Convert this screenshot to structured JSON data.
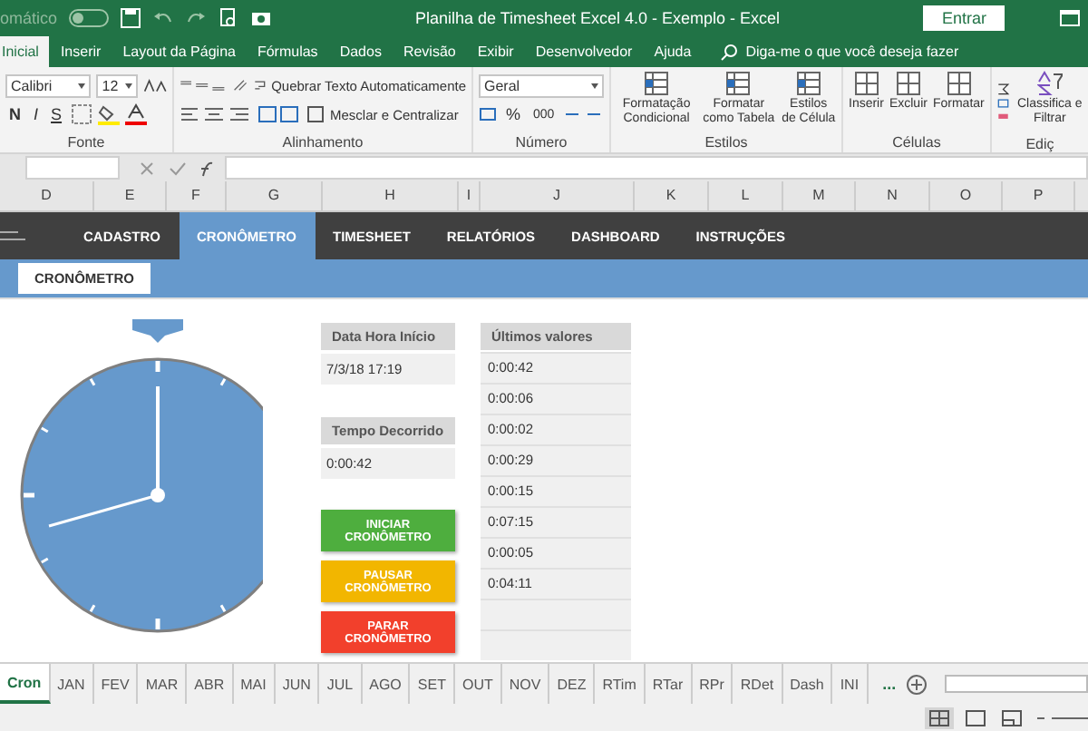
{
  "title_bar": {
    "autosave_label": "omático",
    "autosave_on": false,
    "title": "Planilha de Timesheet Excel 4.0 - Exemplo  -  Excel",
    "sign_in": "Entrar"
  },
  "ribbon_tabs": [
    {
      "label": "Inicial",
      "selected": true
    },
    {
      "label": "Inserir",
      "selected": false
    },
    {
      "label": "Layout da Página",
      "selected": false
    },
    {
      "label": "Fórmulas",
      "selected": false
    },
    {
      "label": "Dados",
      "selected": false
    },
    {
      "label": "Revisão",
      "selected": false
    },
    {
      "label": "Exibir",
      "selected": false
    },
    {
      "label": "Desenvolvedor",
      "selected": false
    },
    {
      "label": "Ajuda",
      "selected": false
    }
  ],
  "tell_me": "Diga-me o que você deseja fazer",
  "ribbon": {
    "font_name": "Calibri",
    "font_size": "12",
    "bold": "N",
    "italic": "I",
    "underline": "S",
    "wrap_text": "Quebrar Texto Automaticamente",
    "merge": "Mesclar e Centralizar",
    "number_format": "Geral",
    "percent": "%",
    "thousands": "000",
    "styles": [
      "Formatação Condicional",
      "Formatar como Tabela",
      "Estilos de Célula"
    ],
    "cells": [
      "Inserir",
      "Excluir",
      "Formatar"
    ],
    "sort": "Classifica e Filtrar",
    "groups": [
      "Fonte",
      "Alinhamento",
      "Número",
      "Estilos",
      "Células",
      "Ediç"
    ]
  },
  "columns": [
    "D",
    "E",
    "F",
    "G",
    "H",
    "I",
    "J",
    "K",
    "L",
    "M",
    "N",
    "O",
    "P"
  ],
  "nav": [
    {
      "label": "CADASTRO",
      "selected": false
    },
    {
      "label": "CRONÔMETRO",
      "selected": true
    },
    {
      "label": "TIMESHEET",
      "selected": false
    },
    {
      "label": "RELATÓRIOS",
      "selected": false
    },
    {
      "label": "DASHBOARD",
      "selected": false
    },
    {
      "label": "INSTRUÇÕES",
      "selected": false
    }
  ],
  "subtab": "CRONÔMETRO",
  "fields": [
    {
      "label": "Data Hora Início",
      "value": "7/3/18 17:19"
    },
    {
      "label": "Tempo Decorrido",
      "value": "0:00:42"
    }
  ],
  "buttons": [
    {
      "label": "INICIAR CRONÔMETRO",
      "color": "#4eae3e"
    },
    {
      "label": "PAUSAR CRONÔMETRO",
      "color": "#f2b600"
    },
    {
      "label": "PARAR CRONÔMETRO",
      "color": "#f2402c"
    }
  ],
  "last_values": {
    "header": "Últimos valores",
    "values": [
      "0:00:42",
      "0:00:06",
      "0:00:02",
      "0:00:29",
      "0:00:15",
      "0:07:15",
      "0:00:05",
      "0:04:11"
    ]
  },
  "sheet_tabs": [
    {
      "label": "Cron",
      "selected": true
    },
    {
      "label": "JAN",
      "selected": false
    },
    {
      "label": "FEV",
      "selected": false
    },
    {
      "label": "MAR",
      "selected": false
    },
    {
      "label": "ABR",
      "selected": false
    },
    {
      "label": "MAI",
      "selected": false
    },
    {
      "label": "JUN",
      "selected": false
    },
    {
      "label": "JUL",
      "selected": false
    },
    {
      "label": "AGO",
      "selected": false
    },
    {
      "label": "SET",
      "selected": false
    },
    {
      "label": "OUT",
      "selected": false
    },
    {
      "label": "NOV",
      "selected": false
    },
    {
      "label": "DEZ",
      "selected": false
    },
    {
      "label": "RTim",
      "selected": false
    },
    {
      "label": "RTar",
      "selected": false
    },
    {
      "label": "RPr",
      "selected": false
    },
    {
      "label": "RDet",
      "selected": false
    },
    {
      "label": "Dash",
      "selected": false
    },
    {
      "label": "INI",
      "selected": false
    }
  ],
  "more_tabs": "..."
}
